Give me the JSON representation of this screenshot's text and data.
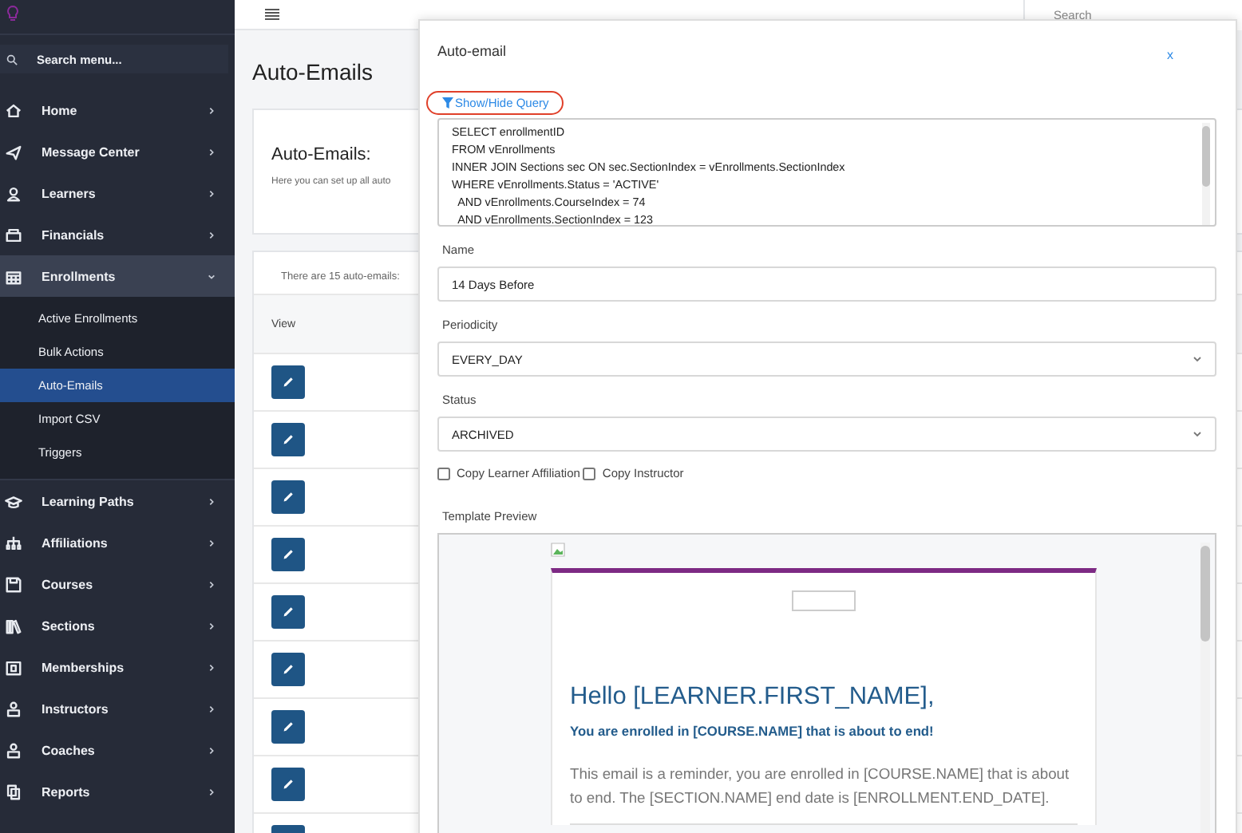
{
  "sidebar": {
    "search": {
      "placeholder": "Search menu..."
    },
    "items": [
      {
        "label": "Home",
        "expanded": false
      },
      {
        "label": "Message Center",
        "expanded": false
      },
      {
        "label": "Learners",
        "expanded": false
      },
      {
        "label": "Financials",
        "expanded": false
      },
      {
        "label": "Enrollments",
        "expanded": true,
        "children": [
          {
            "label": "Active Enrollments",
            "selected": false
          },
          {
            "label": "Bulk Actions",
            "selected": false
          },
          {
            "label": "Auto-Emails",
            "selected": true
          },
          {
            "label": "Import CSV",
            "selected": false
          },
          {
            "label": "Triggers",
            "selected": false
          }
        ]
      },
      {
        "label": "Learning Paths",
        "expanded": false
      },
      {
        "label": "Affiliations",
        "expanded": false
      },
      {
        "label": "Courses",
        "expanded": false
      },
      {
        "label": "Sections",
        "expanded": false
      },
      {
        "label": "Memberships",
        "expanded": false
      },
      {
        "label": "Instructors",
        "expanded": false
      },
      {
        "label": "Coaches",
        "expanded": false
      },
      {
        "label": "Reports",
        "expanded": false
      }
    ]
  },
  "top_search": {
    "placeholder": "Search"
  },
  "page": {
    "title": "Auto-Emails",
    "intro": {
      "heading": "Auto-Emails:",
      "text": "Here you can set up all auto"
    },
    "table": {
      "caption": "There are 15 auto-emails:",
      "columns": [
        "View"
      ],
      "rows": [
        {
          "kind": "edit"
        },
        {
          "kind": "edit"
        },
        {
          "kind": "edit"
        },
        {
          "kind": "edit"
        },
        {
          "kind": "edit"
        },
        {
          "kind": "edit"
        },
        {
          "kind": "edit"
        },
        {
          "kind": "edit"
        },
        {
          "kind": "edit"
        }
      ]
    }
  },
  "modal": {
    "title": "Auto-email",
    "close": "x",
    "query_toggle": "Show/Hide Query",
    "query": [
      "SELECT enrollmentID",
      "FROM vEnrollments",
      "INNER JOIN Sections sec ON sec.SectionIndex = vEnrollments.SectionIndex",
      "WHERE vEnrollments.Status = 'ACTIVE'",
      "  AND vEnrollments.CourseIndex = 74",
      "  AND vEnrollments.SectionIndex = 123"
    ],
    "fields": [
      {
        "label": "Name",
        "kind": "text",
        "value": "14 Days Before"
      },
      {
        "label": "Periodicity",
        "kind": "select",
        "value": "EVERY_DAY"
      },
      {
        "label": "Status",
        "kind": "select",
        "value": "ARCHIVED"
      }
    ],
    "checkboxes": [
      {
        "label": "Copy Learner Affiliation",
        "checked": false
      },
      {
        "label": "Copy Instructor",
        "checked": false
      }
    ],
    "preview": {
      "label": "Template Preview",
      "greeting": "Hello [LEARNER.FIRST_NAME],",
      "subheading": "You are enrolled in [COURSE.NAME] that is about to end!",
      "body": "This email is a reminder, you are enrolled in [COURSE.NAME] that is about to end. The [SECTION.NAME] end date is [ENROLLMENT.END_DATE]."
    }
  }
}
